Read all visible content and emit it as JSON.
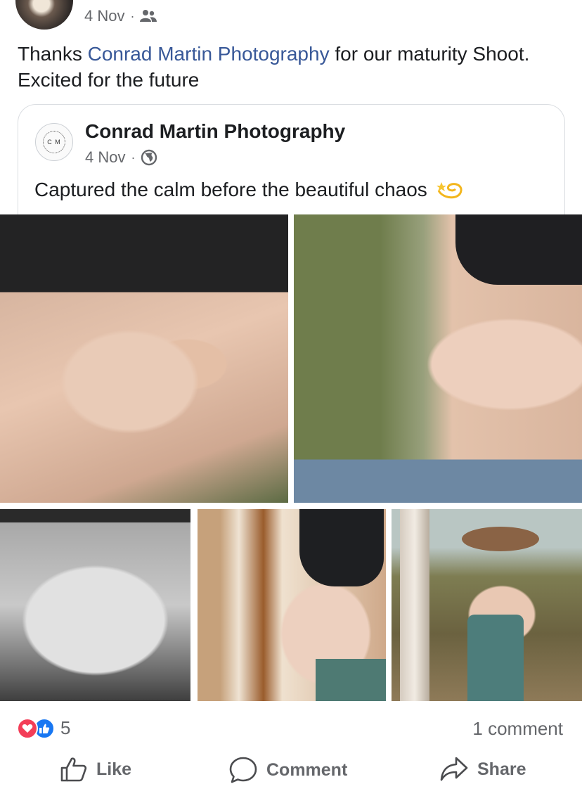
{
  "post": {
    "date": "4 Nov",
    "dot": "·",
    "audience_icon": "friends-icon",
    "text_before": "Thanks ",
    "mention": "Conrad Martin Photography",
    "text_after": " for our maturity Shoot. Excited for the future"
  },
  "shared": {
    "logo_text": "C M",
    "page_name": "Conrad Martin Photography",
    "date": "4 Nov",
    "dot": "·",
    "audience_icon": "globe-icon",
    "text": "Captured the calm before the beautiful chaos",
    "emoji_icon": "dizzy-star-icon"
  },
  "photos": [
    "hands-heart-bump-photo",
    "hands-on-bump-forest-photo",
    "bw-heart-hands-photo",
    "bump-by-tree-photo",
    "full-figure-hat-bouquet-photo"
  ],
  "reactions": {
    "icons": [
      "love-icon",
      "like-icon"
    ],
    "count": "5",
    "comments": "1 comment"
  },
  "actions": {
    "like": "Like",
    "comment": "Comment",
    "share": "Share"
  },
  "colors": {
    "link": "#385898",
    "secondary_text": "#65676b",
    "love": "#f33e58",
    "like": "#1877f2"
  }
}
